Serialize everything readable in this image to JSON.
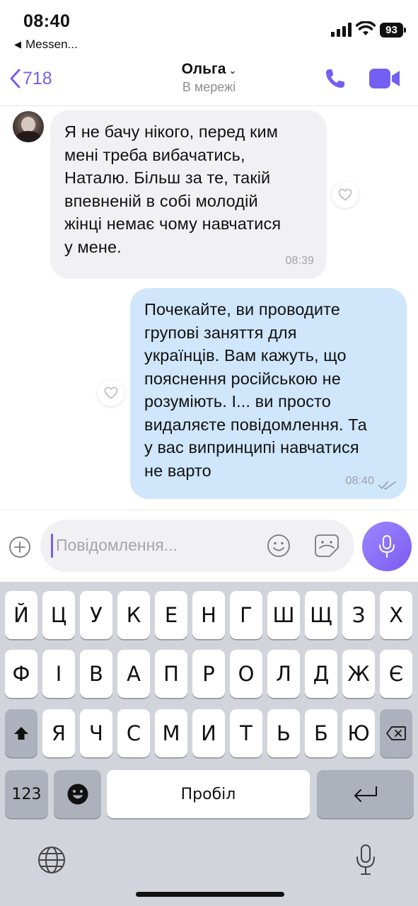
{
  "status_bar": {
    "time": "08:40",
    "back_app": "Messen...",
    "battery": "93"
  },
  "header": {
    "back_count": "718",
    "contact_name": "Ольга",
    "contact_status": "В мережі"
  },
  "messages": [
    {
      "direction": "incoming",
      "lines": [
        "Я не бачу нікого, перед ким",
        "мені треба вибачатись,",
        "Наталю. Більш за те, такій",
        "впевненій в собі молодій",
        "жінці немає чому навчатися",
        "у мене."
      ],
      "time": "08:39"
    },
    {
      "direction": "outgoing",
      "lines": [
        "Почекайте, ви проводите",
        "групові заняття для",
        "українців. Вам кажуть, що",
        "пояснення російською не",
        "розуміють. І... ви просто",
        "видаляєте повідомлення. Та",
        "у вас випринципі навчатися",
        "не варто"
      ],
      "time": "08:40",
      "status": "read"
    }
  ],
  "composer": {
    "placeholder": "Повідомлення..."
  },
  "keyboard": {
    "row1": [
      "Й",
      "Ц",
      "У",
      "К",
      "Е",
      "Н",
      "Г",
      "Ш",
      "Щ",
      "З",
      "Х"
    ],
    "row2": [
      "Ф",
      "І",
      "В",
      "А",
      "П",
      "Р",
      "О",
      "Л",
      "Д",
      "Ж",
      "Є"
    ],
    "row3": [
      "Я",
      "Ч",
      "С",
      "М",
      "И",
      "Т",
      "Ь",
      "Б",
      "Ю"
    ],
    "numbers_label": "123",
    "space_label": "Пробіл"
  },
  "colors": {
    "accent": "#7360f2",
    "incoming_bubble": "#f1f1f3",
    "outgoing_bubble": "#cfe6fb",
    "keyboard_bg": "#d2d4db"
  }
}
